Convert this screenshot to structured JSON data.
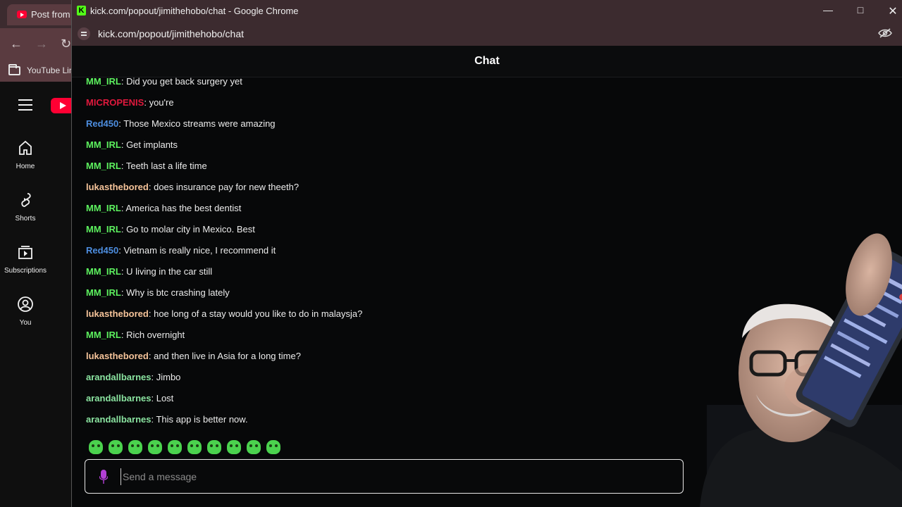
{
  "background_window": {
    "tab_title": "Post from",
    "bookmark_label": "YouTube Lin",
    "sidebar": [
      {
        "label": "Home",
        "icon": "home-icon"
      },
      {
        "label": "Shorts",
        "icon": "shorts-icon"
      },
      {
        "label": "Subscriptions",
        "icon": "subscriptions-icon"
      },
      {
        "label": "You",
        "icon": "account-icon"
      }
    ]
  },
  "popup": {
    "title": "kick.com/popout/jimithehobo/chat - Google Chrome",
    "url": "kick.com/popout/jimithehobo/chat",
    "chat_header": "Chat",
    "input_placeholder": "Send a message"
  },
  "colors": {
    "green_user": "#5df25f",
    "red_user": "#e0193d",
    "blue_user": "#4d8ee0",
    "peach_user": "#f6c49a",
    "light_green_user": "#8ae3a0"
  },
  "messages": [
    {
      "user": "MM_IRL",
      "text": ": Did you get back surgery yet",
      "color": "#5df25f"
    },
    {
      "user": "MICROPENIS",
      "text": ": you're",
      "color": "#e0193d"
    },
    {
      "user": "Red450",
      "text": ": Those Mexico streams were amazing",
      "color": "#4d8ee0"
    },
    {
      "user": "MM_IRL",
      "text": ": Get implants",
      "color": "#5df25f"
    },
    {
      "user": "MM_IRL",
      "text": ": Teeth last a life time",
      "color": "#5df25f"
    },
    {
      "user": "lukasthebored",
      "text": ": does insurance pay for new theeth?",
      "color": "#f6c49a"
    },
    {
      "user": "MM_IRL",
      "text": ": America has the best dentist",
      "color": "#5df25f"
    },
    {
      "user": "MM_IRL",
      "text": ": Go to molar city in Mexico. Best",
      "color": "#5df25f"
    },
    {
      "user": "Red450",
      "text": ": Vietnam is really nice, I recommend it",
      "color": "#4d8ee0"
    },
    {
      "user": "MM_IRL",
      "text": ": U living in the car still",
      "color": "#5df25f"
    },
    {
      "user": "MM_IRL",
      "text": ": Why is btc crashing lately",
      "color": "#5df25f"
    },
    {
      "user": "lukasthebored",
      "text": ": hoe long of a stay would you like to do in malaysja?",
      "color": "#f6c49a"
    },
    {
      "user": "MM_IRL",
      "text": ": Rich overnight",
      "color": "#5df25f"
    },
    {
      "user": "lukasthebored",
      "text": ": and then live in Asia for a long time?",
      "color": "#f6c49a"
    },
    {
      "user": "arandallbarnes",
      "text": ": Jimbo",
      "color": "#8ae3a0"
    },
    {
      "user": "arandallbarnes",
      "text": ": Lost",
      "color": "#8ae3a0"
    },
    {
      "user": "arandallbarnes",
      "text": ": This app is better now.",
      "color": "#8ae3a0"
    }
  ],
  "emotes": [
    "emote-1",
    "emote-2",
    "emote-3",
    "emote-4",
    "emote-5",
    "emote-6",
    "emote-7",
    "emote-8",
    "emote-9",
    "emote-10"
  ]
}
